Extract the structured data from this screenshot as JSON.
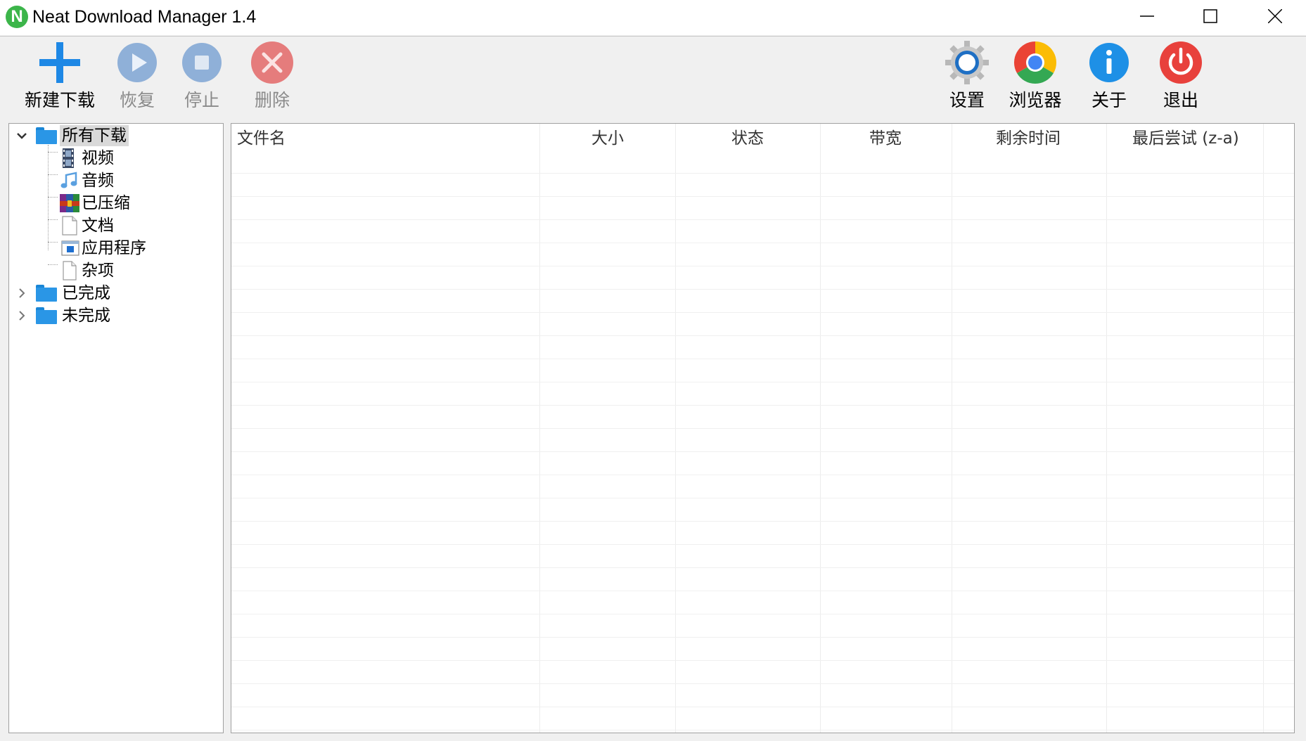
{
  "window": {
    "title": "Neat Download Manager 1.4",
    "app_icon_letter": "N",
    "controls": [
      "minimize",
      "maximize",
      "close"
    ]
  },
  "toolbar": {
    "left": [
      {
        "label": "新建下载",
        "icon": "plus-icon",
        "enabled": true,
        "color": "#1e88e5"
      },
      {
        "label": "恢复",
        "icon": "play-icon",
        "enabled": false,
        "color": "#8fb0d8"
      },
      {
        "label": "停止",
        "icon": "stop-icon",
        "enabled": false,
        "color": "#8fb0d8"
      },
      {
        "label": "删除",
        "icon": "delete-icon",
        "enabled": false,
        "color": "#e57c7c"
      }
    ],
    "right": [
      {
        "label": "设置",
        "icon": "gear-icon",
        "enabled": true
      },
      {
        "label": "浏览器",
        "icon": "chrome-icon",
        "enabled": true
      },
      {
        "label": "关于",
        "icon": "info-icon",
        "enabled": true,
        "color": "#1e90e6"
      },
      {
        "label": "退出",
        "icon": "power-icon",
        "enabled": true,
        "color": "#e8413c"
      }
    ]
  },
  "tree": {
    "root": {
      "label": "所有下载",
      "icon": "folder-icon",
      "expanded": true,
      "selected": true
    },
    "children": [
      {
        "label": "视频",
        "icon": "film-icon"
      },
      {
        "label": "音频",
        "icon": "music-note-icon"
      },
      {
        "label": "已压缩",
        "icon": "archive-icon"
      },
      {
        "label": "文档",
        "icon": "document-icon"
      },
      {
        "label": "应用程序",
        "icon": "application-icon"
      },
      {
        "label": "杂项",
        "icon": "blank-file-icon"
      }
    ],
    "siblings": [
      {
        "label": "已完成",
        "icon": "folder-icon",
        "expanded": false
      },
      {
        "label": "未完成",
        "icon": "folder-icon",
        "expanded": false
      }
    ]
  },
  "list": {
    "columns": [
      "文件名",
      "大小",
      "状态",
      "带宽",
      "剩余时间",
      "最后尝试 (z-a)"
    ],
    "rows": []
  }
}
